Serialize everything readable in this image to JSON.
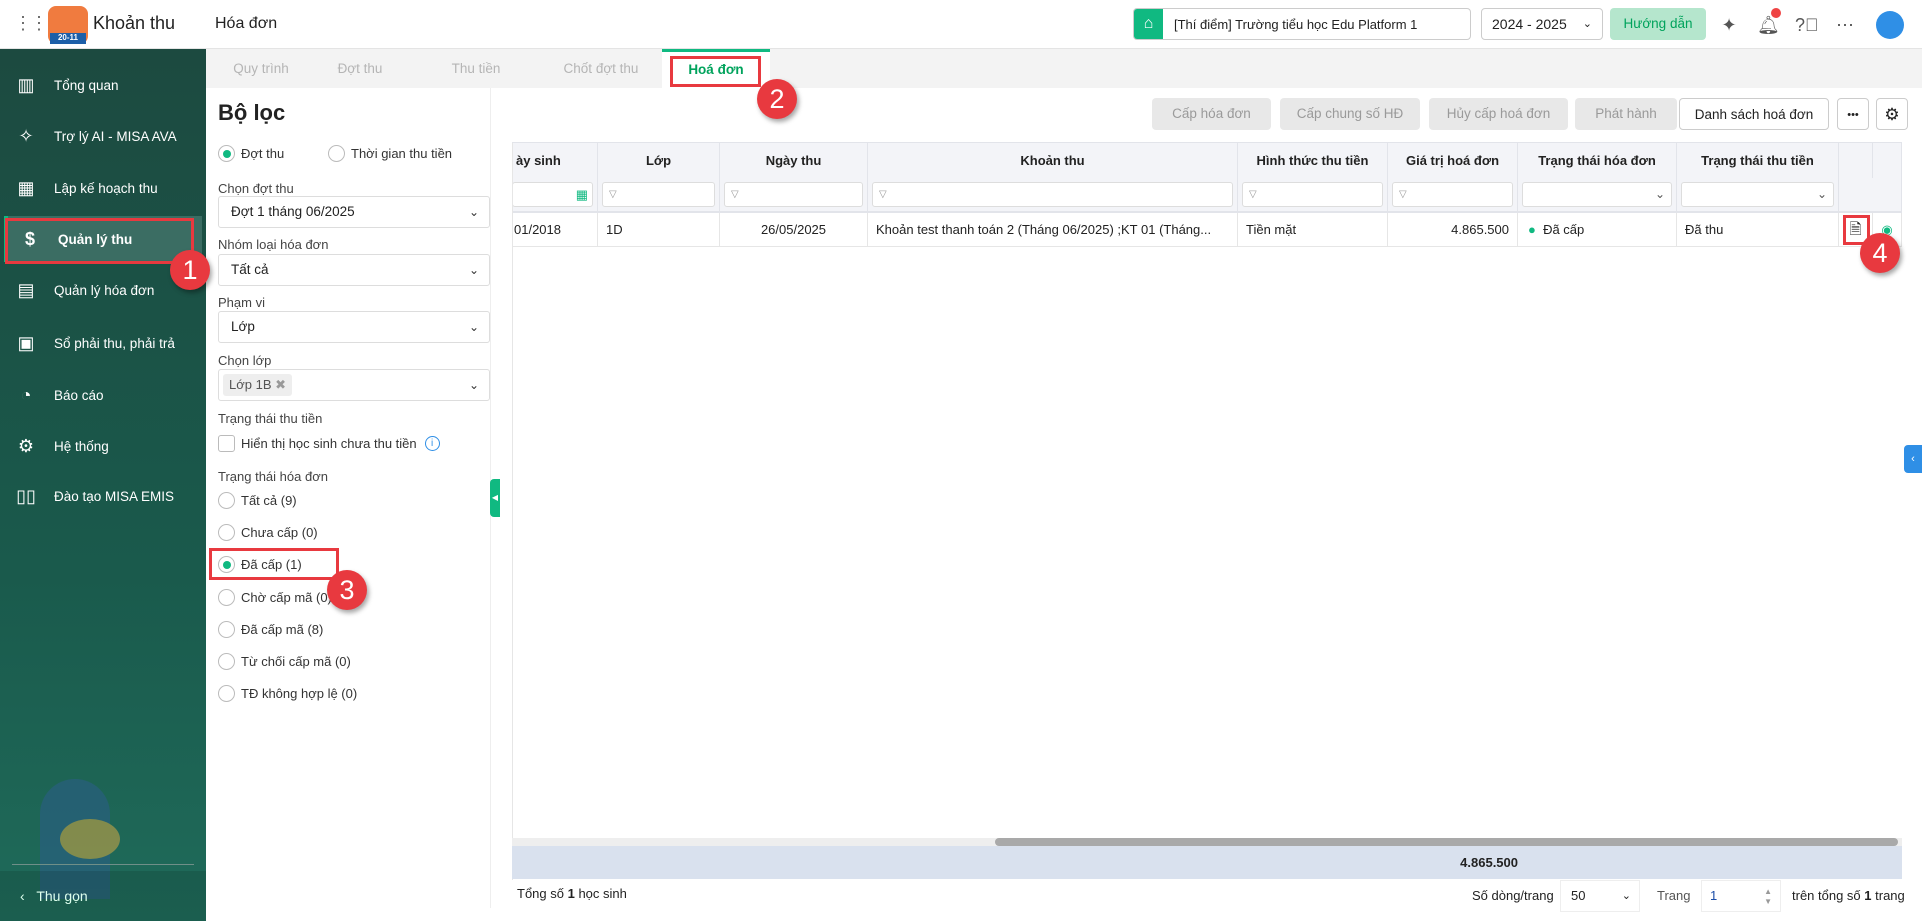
{
  "header": {
    "app_name": "Khoản thu",
    "logo_badge": "20-11",
    "page_title": "Hóa đơn",
    "school": "[Thí điểm] Trường tiểu học Edu Platform 1",
    "year": "2024 - 2025",
    "guide_button": "Hướng dẫn"
  },
  "sidebar": {
    "items": [
      {
        "label": "Tổng quan",
        "icon": "chart-icon"
      },
      {
        "label": "Trợ lý AI - MISA AVA",
        "icon": "sparkle-icon"
      },
      {
        "label": "Lập kế hoạch thu",
        "icon": "calendar-dollar-icon"
      },
      {
        "label": "Quản lý thu",
        "icon": "money-hand-icon"
      },
      {
        "label": "Quản lý hóa đơn",
        "icon": "invoice-icon"
      },
      {
        "label": "Sổ phải thu, phải trả",
        "icon": "ledger-icon"
      },
      {
        "label": "Báo cáo",
        "icon": "pie-chart-icon"
      },
      {
        "label": "Hệ thống",
        "icon": "gear-icon"
      },
      {
        "label": "Đào tạo MISA EMIS",
        "icon": "book-icon"
      }
    ],
    "collapse": "Thu gọn"
  },
  "tabs": [
    "Quy trình",
    "Đợt thu",
    "Thu tiền",
    "Chốt đợt thu",
    "Hoá đơn"
  ],
  "filter": {
    "title": "Bộ lọc",
    "mode_options": [
      "Đợt thu",
      "Thời gian thu tiền"
    ],
    "batch_label": "Chọn đợt thu",
    "batch_value": "Đợt 1 tháng 06/2025",
    "group_label": "Nhóm loại hóa đơn",
    "group_value": "Tất cả",
    "scope_label": "Phạm vi",
    "scope_value": "Lớp",
    "class_label": "Chọn lớp",
    "class_tag": "Lớp 1B",
    "payment_status_label": "Trạng thái thu tiền",
    "show_unpaid": "Hiển thị học sinh chưa thu tiền",
    "invoice_status_label": "Trạng thái hóa đơn",
    "invoice_status_options": [
      "Tất cả (9)",
      "Chưa cấp (0)",
      "Đã cấp (1)",
      "Chờ cấp mã (0)",
      "Đã cấp mã (8)",
      "Từ chối cấp mã (0)",
      "TĐ không hợp lệ (0)"
    ]
  },
  "toolbar": {
    "issue": "Cấp hóa đơn",
    "issue_common": "Cấp chung số HĐ",
    "cancel_issue": "Hủy cấp hoá đơn",
    "publish": "Phát hành",
    "list": "Danh sách hoá đơn",
    "more": "•••"
  },
  "table": {
    "columns": [
      "ày sinh",
      "Lớp",
      "Ngày thu",
      "Khoản thu",
      "Hình thức thu tiền",
      "Giá trị hoá đơn",
      "Trạng thái hóa đơn",
      "Trạng thái thu tiền"
    ],
    "rows": [
      {
        "dob": "01/2018",
        "class": "1D",
        "date": "26/05/2025",
        "item": "Khoản test thanh toán 2 (Tháng 06/2025) ;KT 01 (Tháng...",
        "method": "Tiền mặt",
        "amount": "4.865.500",
        "invoice_status": "Đã cấp",
        "payment_status": "Đã thu"
      }
    ],
    "total": "4.865.500"
  },
  "footer": {
    "total_prefix": "Tổng số ",
    "total_count": "1",
    "total_suffix": " học sinh",
    "rows_label": "Số dòng/trang",
    "rows_value": "50",
    "page_label": "Trang",
    "page_value": "1",
    "of_prefix": "trên tổng số ",
    "of_count": "1",
    "of_suffix": " trang"
  },
  "annotations": [
    "1",
    "2",
    "3",
    "4"
  ],
  "colors": {
    "accent": "#10b981",
    "sidebar": "#1c4a40",
    "annotation": "#e8393f"
  }
}
